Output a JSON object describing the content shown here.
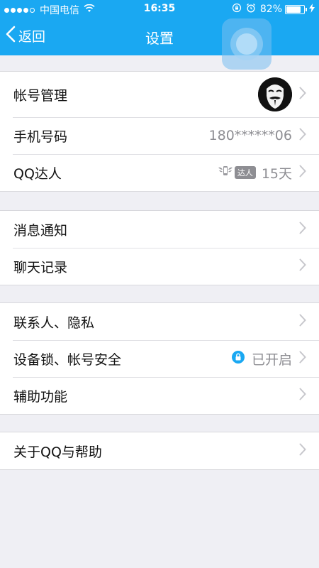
{
  "status_bar": {
    "carrier": "中国电信",
    "time": "16:35",
    "battery": "82%",
    "battery_level": 0.82,
    "signal_bars": 4
  },
  "nav": {
    "back_label": "返回",
    "title": "设置"
  },
  "groups": [
    {
      "rows": [
        {
          "label": "帐号管理",
          "value": ""
        },
        {
          "label": "手机号码",
          "value": "180******06"
        },
        {
          "label": "QQ达人",
          "value": "15天",
          "badge": "达人"
        }
      ]
    },
    {
      "rows": [
        {
          "label": "消息通知",
          "value": ""
        },
        {
          "label": "聊天记录",
          "value": ""
        }
      ]
    },
    {
      "rows": [
        {
          "label": "联系人、隐私",
          "value": ""
        },
        {
          "label": "设备锁、帐号安全",
          "value": "已开启"
        },
        {
          "label": "辅助功能",
          "value": ""
        }
      ]
    },
    {
      "rows": [
        {
          "label": "关于QQ与帮助",
          "value": ""
        }
      ]
    }
  ],
  "colors": {
    "accent": "#1aa8f2",
    "background": "#efeff4",
    "secondary_text": "#8e8e93",
    "lock_icon": "#1aa8f2"
  },
  "icons": {
    "back": "chevron-left-icon",
    "row_arrow": "chevron-right-icon",
    "lock": "lock-icon",
    "avatar": "mask-avatar",
    "wifi": "wifi-icon",
    "alarm": "alarm-icon",
    "orientation_lock": "orientation-lock-icon",
    "charging": "charging-bolt-icon"
  }
}
